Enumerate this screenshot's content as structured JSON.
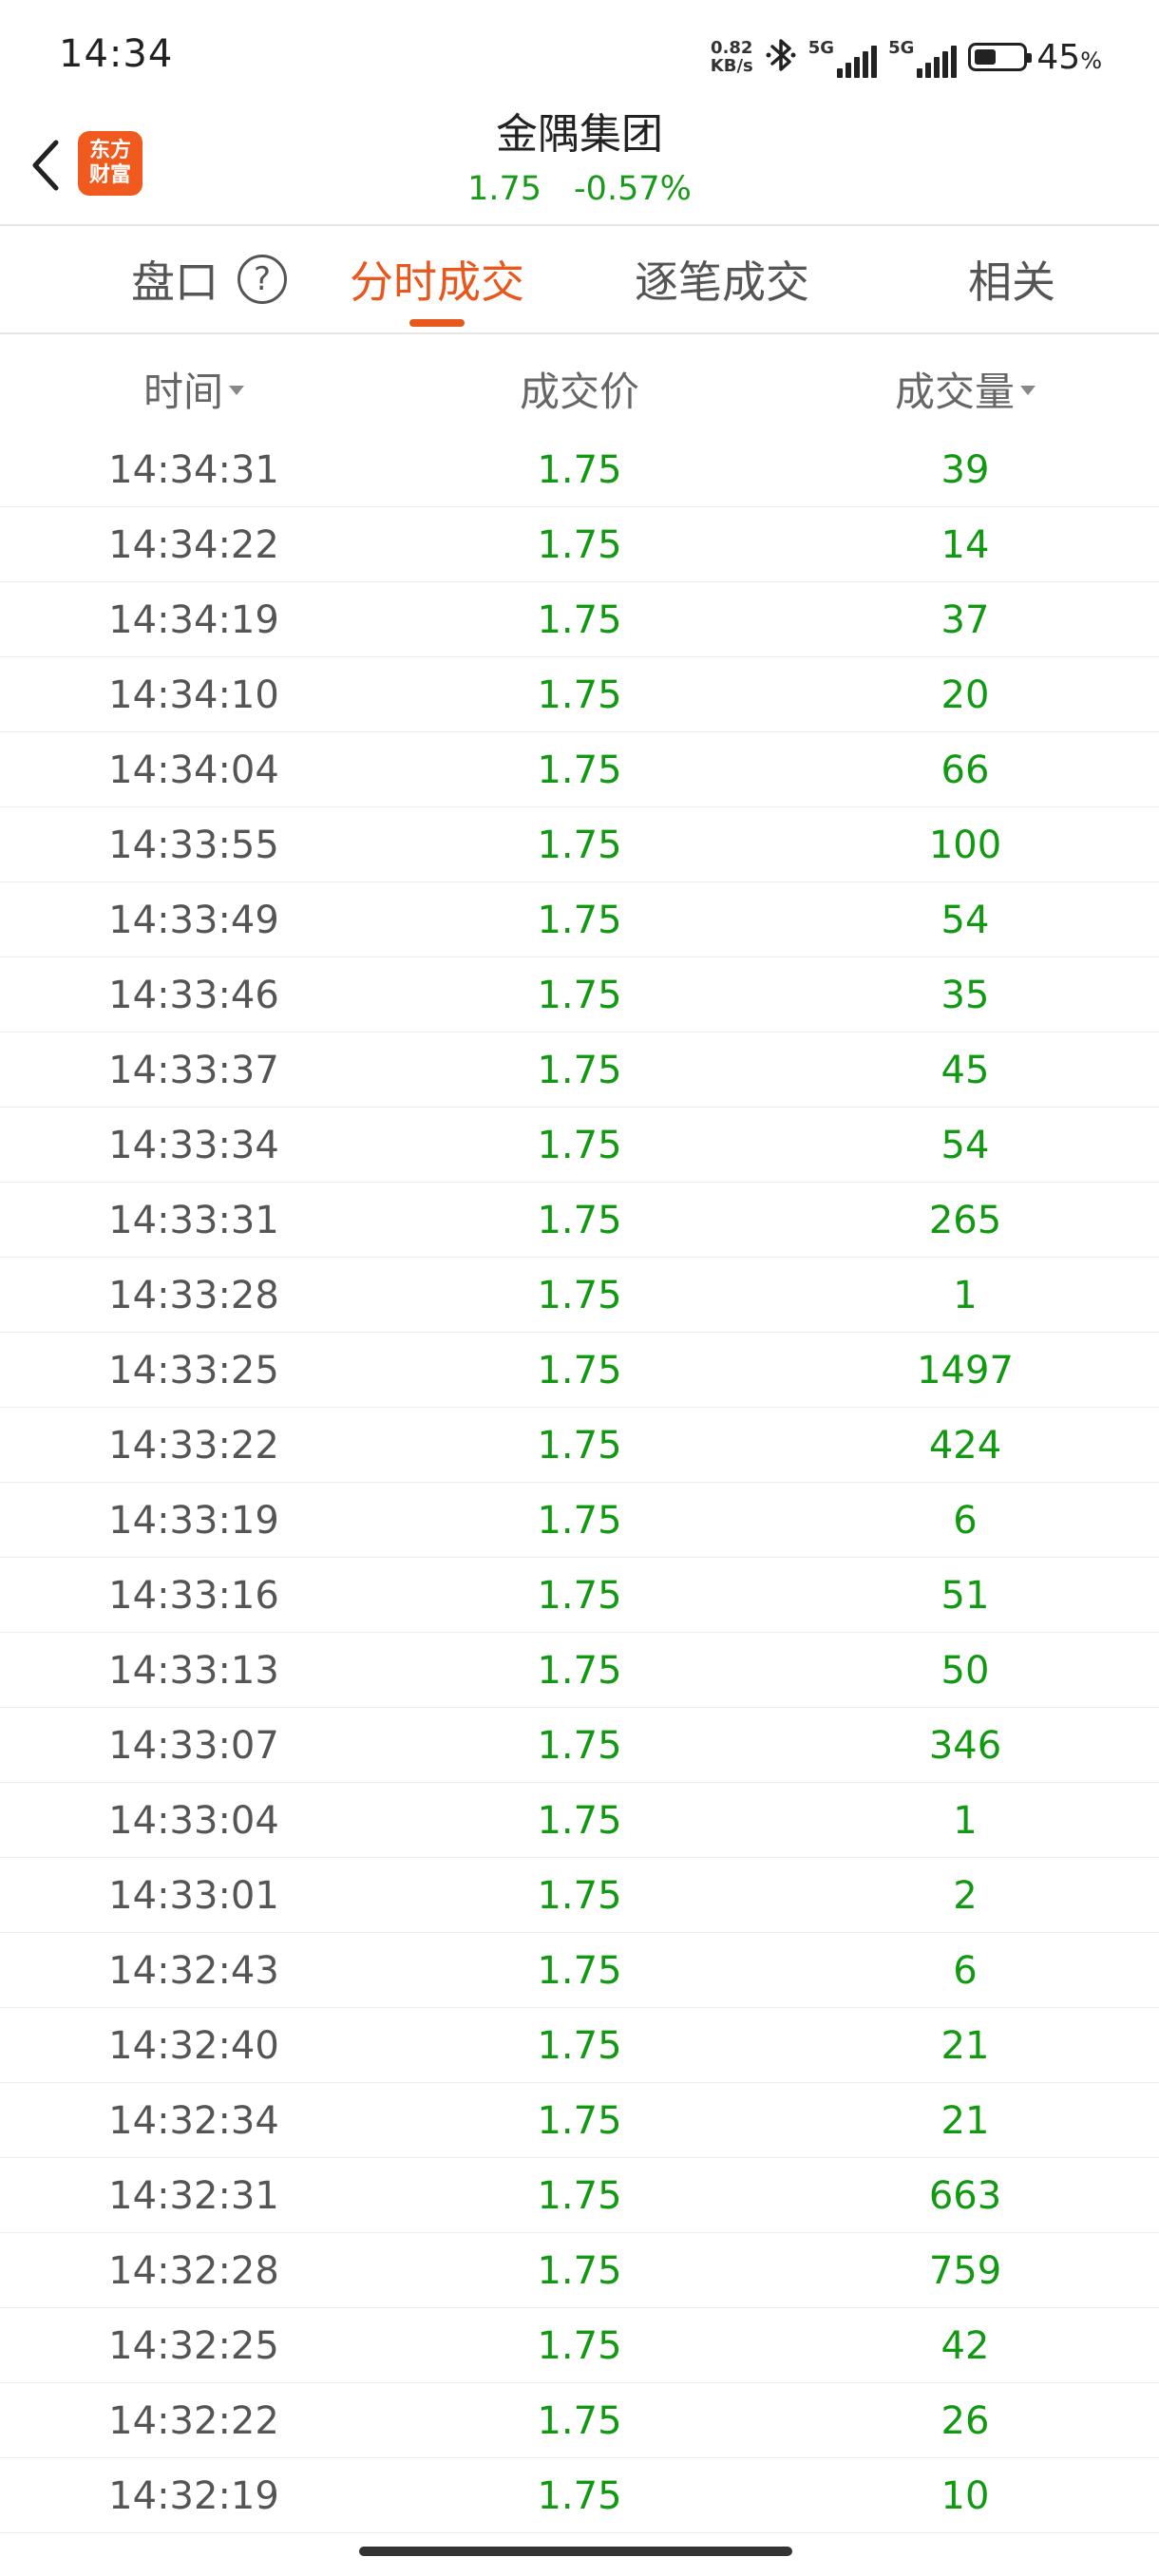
{
  "status_bar": {
    "time": "14:34",
    "net_speed_value": "0.82",
    "net_speed_unit": "KB/s",
    "sim1_label": "5G",
    "sim2_label": "5G",
    "battery_percent": "45",
    "battery_level": 0.45,
    "icons": [
      "bluetooth-icon",
      "signal-icon",
      "battery-icon"
    ]
  },
  "header": {
    "logo_line1": "东方",
    "logo_line2": "财富",
    "stock_name": "金隅集团",
    "price": "1.75",
    "change_pct": "-0.57%",
    "price_color": "#1a9a1a"
  },
  "tabs": [
    {
      "label": "盘口"
    },
    {
      "label": "分时成交"
    },
    {
      "label": "逐笔成交"
    },
    {
      "label": "相关"
    }
  ],
  "active_tab_index": 1,
  "accent_color": "#e8571c",
  "table": {
    "columns": [
      "时间",
      "成交价",
      "成交量"
    ],
    "rows": [
      {
        "time": "14:34:31",
        "price": "1.75",
        "volume": "39"
      },
      {
        "time": "14:34:22",
        "price": "1.75",
        "volume": "14"
      },
      {
        "time": "14:34:19",
        "price": "1.75",
        "volume": "37"
      },
      {
        "time": "14:34:10",
        "price": "1.75",
        "volume": "20"
      },
      {
        "time": "14:34:04",
        "price": "1.75",
        "volume": "66"
      },
      {
        "time": "14:33:55",
        "price": "1.75",
        "volume": "100"
      },
      {
        "time": "14:33:49",
        "price": "1.75",
        "volume": "54"
      },
      {
        "time": "14:33:46",
        "price": "1.75",
        "volume": "35"
      },
      {
        "time": "14:33:37",
        "price": "1.75",
        "volume": "45"
      },
      {
        "time": "14:33:34",
        "price": "1.75",
        "volume": "54"
      },
      {
        "time": "14:33:31",
        "price": "1.75",
        "volume": "265"
      },
      {
        "time": "14:33:28",
        "price": "1.75",
        "volume": "1"
      },
      {
        "time": "14:33:25",
        "price": "1.75",
        "volume": "1497"
      },
      {
        "time": "14:33:22",
        "price": "1.75",
        "volume": "424"
      },
      {
        "time": "14:33:19",
        "price": "1.75",
        "volume": "6"
      },
      {
        "time": "14:33:16",
        "price": "1.75",
        "volume": "51"
      },
      {
        "time": "14:33:13",
        "price": "1.75",
        "volume": "50"
      },
      {
        "time": "14:33:07",
        "price": "1.75",
        "volume": "346"
      },
      {
        "time": "14:33:04",
        "price": "1.75",
        "volume": "1"
      },
      {
        "time": "14:33:01",
        "price": "1.75",
        "volume": "2"
      },
      {
        "time": "14:32:43",
        "price": "1.75",
        "volume": "6"
      },
      {
        "time": "14:32:40",
        "price": "1.75",
        "volume": "21"
      },
      {
        "time": "14:32:34",
        "price": "1.75",
        "volume": "21"
      },
      {
        "time": "14:32:31",
        "price": "1.75",
        "volume": "663"
      },
      {
        "time": "14:32:28",
        "price": "1.75",
        "volume": "759"
      },
      {
        "time": "14:32:25",
        "price": "1.75",
        "volume": "42"
      },
      {
        "time": "14:32:22",
        "price": "1.75",
        "volume": "26"
      },
      {
        "time": "14:32:19",
        "price": "1.75",
        "volume": "10"
      }
    ]
  }
}
